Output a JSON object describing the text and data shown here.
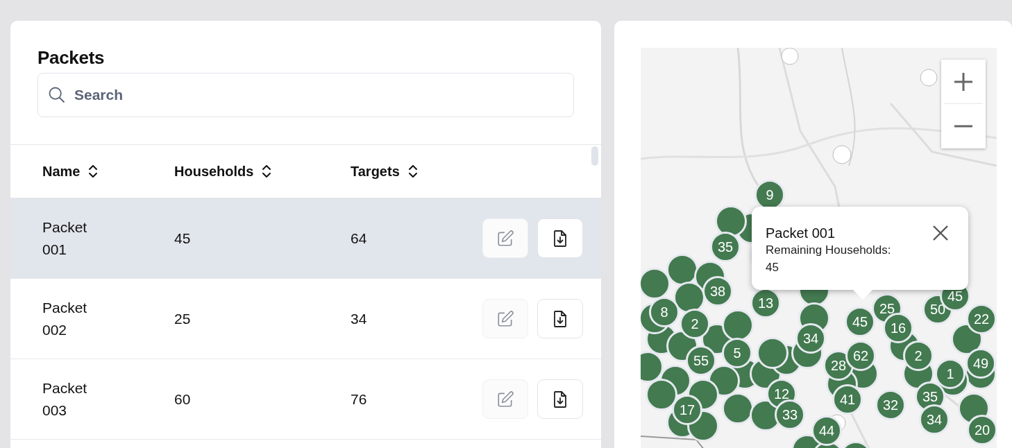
{
  "packets": {
    "title": "Packets",
    "search": {
      "placeholder": "Search"
    },
    "columns": [
      {
        "label": "Name",
        "sortable": true
      },
      {
        "label": "Households",
        "sortable": true
      },
      {
        "label": "Targets",
        "sortable": true
      }
    ],
    "rows": [
      {
        "name": "Packet 001",
        "households": "45",
        "targets": "64",
        "selected": true,
        "edit_disabled": true
      },
      {
        "name": "Packet 002",
        "households": "25",
        "targets": "34",
        "selected": false,
        "edit_disabled": true
      },
      {
        "name": "Packet 003",
        "households": "60",
        "targets": "76",
        "selected": false,
        "edit_disabled": true
      }
    ]
  },
  "map": {
    "kind": "picture",
    "markers": [
      "9",
      "35",
      "38",
      "13",
      "8",
      "2",
      "5",
      "55",
      "34",
      "28",
      "62",
      "45",
      "25",
      "16",
      "50",
      "45",
      "2",
      "1",
      "22",
      "49",
      "35",
      "34",
      "32",
      "41",
      "12",
      "33",
      "44",
      "17",
      "20"
    ],
    "popup": {
      "title": "Packet 001",
      "label": "Remaining Households:",
      "value": "45"
    }
  }
}
